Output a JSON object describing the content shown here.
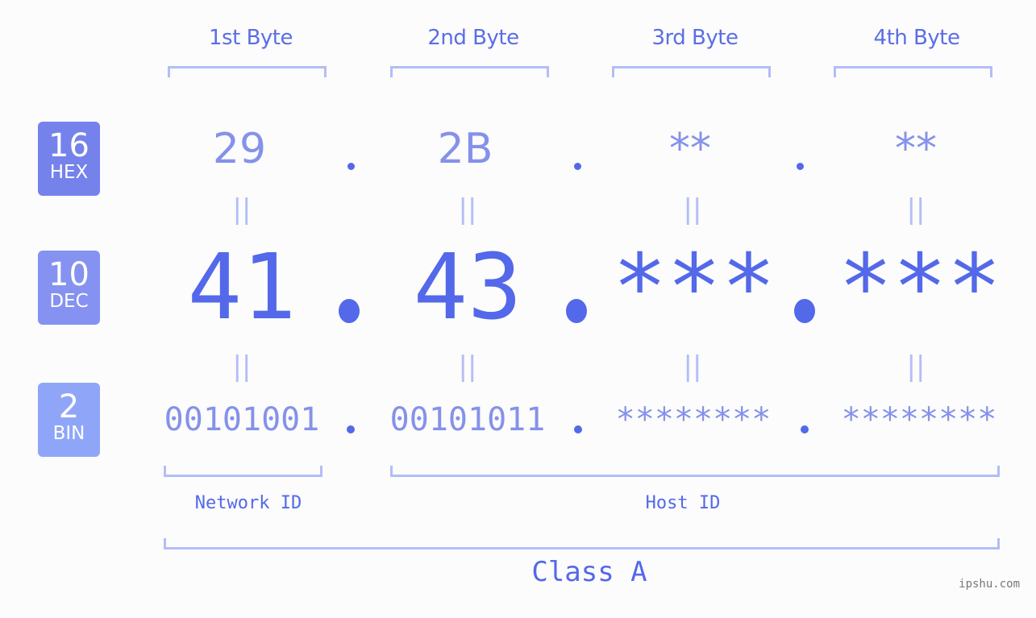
{
  "bytes": [
    {
      "label": "1st Byte",
      "hex": "29",
      "dec": "41",
      "bin": "00101001"
    },
    {
      "label": "2nd Byte",
      "hex": "2B",
      "dec": "43",
      "bin": "00101011"
    },
    {
      "label": "3rd Byte",
      "hex": "**",
      "dec": "***",
      "bin": "********"
    },
    {
      "label": "4th Byte",
      "hex": "**",
      "dec": "***",
      "bin": "********"
    }
  ],
  "badges": {
    "hex": {
      "num": "16",
      "label": "HEX",
      "color": "#7582ec"
    },
    "dec": {
      "num": "10",
      "label": "DEC",
      "color": "#8592f1"
    },
    "bin": {
      "num": "2",
      "label": "BIN",
      "color": "#8fa6f8"
    }
  },
  "equals_symbol": "||",
  "network_id_label": "Network ID",
  "host_id_label": "Host ID",
  "class_label": "Class A",
  "watermark": "ipshu.com",
  "colors": {
    "primary": "#5468ea",
    "secondary": "#8591ea",
    "bracket": "#b3bdf7",
    "background": "#fbfcfb"
  }
}
